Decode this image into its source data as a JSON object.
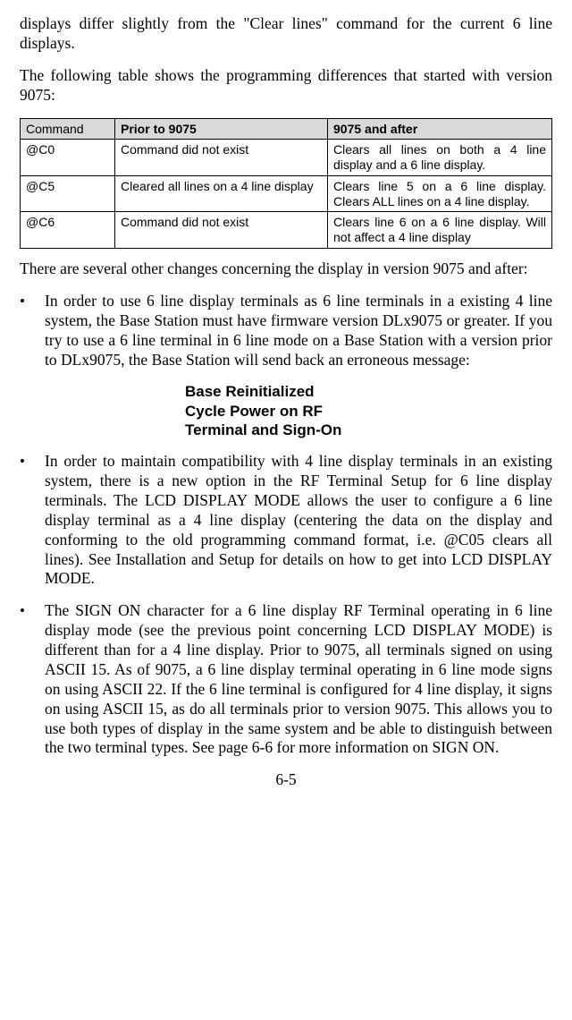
{
  "para_top": "displays differ slightly from the \"Clear lines\" command for the current 6 line displays.",
  "para_intro": "The following table shows the programming differences that started with version 9075:",
  "table": {
    "headers": {
      "c0": "Command",
      "c1": "Prior to 9075",
      "c2": "9075 and after"
    },
    "rows": [
      {
        "cmd": "@C0",
        "prior": "Command did not exist",
        "after": "Clears all lines on both a 4 line display and a 6 line display."
      },
      {
        "cmd": "@C5",
        "prior": "Cleared all lines on a 4 line display",
        "after": "Clears line 5 on a 6 line display. Clears ALL lines on a 4 line display."
      },
      {
        "cmd": "@C6",
        "prior": "Command did not exist",
        "after": "Clears line 6 on a 6 line display.  Will not affect a 4 line display"
      }
    ]
  },
  "para_after_table": "There are several other changes concerning the display in version 9075 and after:",
  "bullets": {
    "b1": "In order to use 6 line display terminals as 6 line terminals in a existing 4 line system, the Base Station must have firmware version DLx9075 or greater.  If you try to use a 6 line terminal in 6 line mode on a Base Station with a version prior to DLx9075, the Base Station will send back an erroneous message:",
    "center": "Base Reinitialized\nCycle Power on RF\nTerminal and Sign-On",
    "b2": "In order to maintain compatibility with 4 line display terminals in an existing system, there is a new option in the RF Terminal Setup for 6 line display terminals.  The LCD DISPLAY MODE allows the user to configure a 6 line display terminal as a 4 line display (centering the data on the display and conforming to the old programming command format, i.e. @C05 clears all lines). See Installation and Setup for details on how to get into LCD DISPLAY MODE.",
    "b3": "The SIGN ON character for a 6 line display RF Terminal operating in 6 line display mode (see the previous point concerning LCD DISPLAY MODE) is different than for a 4 line display.  Prior to 9075, all terminals signed on using ASCII 15. As of 9075, a 6 line display terminal operating in 6 line mode signs on using ASCII 22. If the 6 line terminal is configured for 4 line display, it signs on using ASCII 15, as do all terminals prior to version 9075.  This allows you to use both types of display in the same system and be able to distinguish between the two terminal types.  See page 6-6 for more information on SIGN ON."
  },
  "page_number": "6-5"
}
